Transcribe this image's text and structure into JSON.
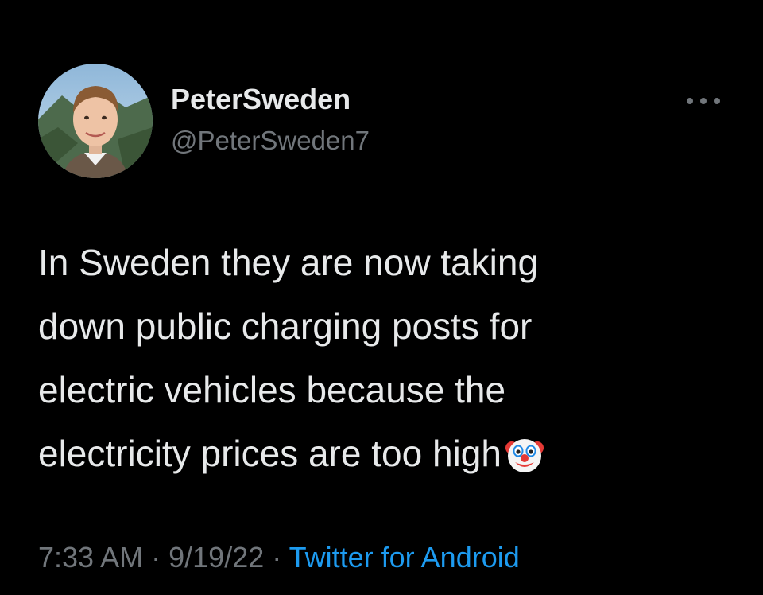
{
  "tweet": {
    "author": {
      "display_name": "PeterSweden",
      "handle": "@PeterSweden7"
    },
    "text": "In Sweden they are now taking\ndown public charging posts for\nelectric vehicles because the\nelectricity prices are too high",
    "emoji": "clown-face-icon",
    "time": "7:33 AM",
    "separator": "·",
    "date": "9/19/22",
    "source": "Twitter for Android"
  },
  "colors": {
    "background": "#000000",
    "primary_text": "#e7e9ea",
    "secondary_text": "#71767b",
    "link": "#1d9bf0",
    "divider": "#2f3336"
  }
}
